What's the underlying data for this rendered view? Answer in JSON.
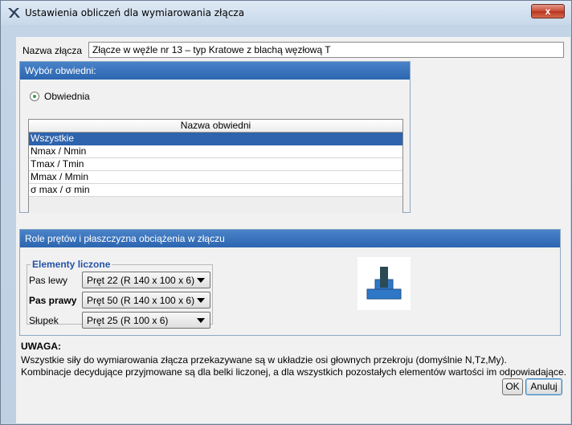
{
  "window": {
    "title": "Ustawienia obliczeń dla wymiarowania złącza",
    "close_label": "x"
  },
  "name_row": {
    "label": "Nazwa złącza",
    "value": "Złącze w węźle nr 13 – typ Kratowe z blachą węzłową T"
  },
  "envelope_panel": {
    "header": "Wybór obwiedni:",
    "radio_label": "Obwiednia",
    "grid_header": "Nazwa obwiedni",
    "rows": [
      "Wszystkie",
      "Nmax / Nmin",
      "Tmax / Tmin",
      "Mmax / Mmin",
      "σ max / σ min"
    ],
    "selected_index": 0
  },
  "roles_panel": {
    "header": "Role prętów i płaszczyzna obciążenia w złączu",
    "group_title": "Elementy liczone",
    "members": [
      {
        "label": "Pas lewy",
        "value": "Pręt 22 (R 140 x 100 x 6)",
        "bold": false
      },
      {
        "label": "Pas prawy",
        "value": "Pręt 50 (R 140 x 100 x 6)",
        "bold": true
      },
      {
        "label": "Słupek",
        "value": "Pręt 25 (R 100 x 6)",
        "bold": false
      }
    ]
  },
  "note": {
    "title": "UWAGA:",
    "line1": "Wszystkie siły do wymiarowania złącza przekazywane są w układzie osi głownych przekroju (domyślnie N,Tz,My).",
    "line2": "Kombinacje decydujące przyjmowane są dla belki liczonej, a dla wszystkich pozostałych elementów wartości im odpowiadające."
  },
  "buttons": {
    "ok": "OK",
    "cancel": "Anuluj"
  },
  "colors": {
    "panel_header": "#2c66b0",
    "selection": "#2e63ad",
    "group_title": "#2552a8",
    "joint_blue": "#2f78c8",
    "joint_dark": "#2b4a56"
  }
}
